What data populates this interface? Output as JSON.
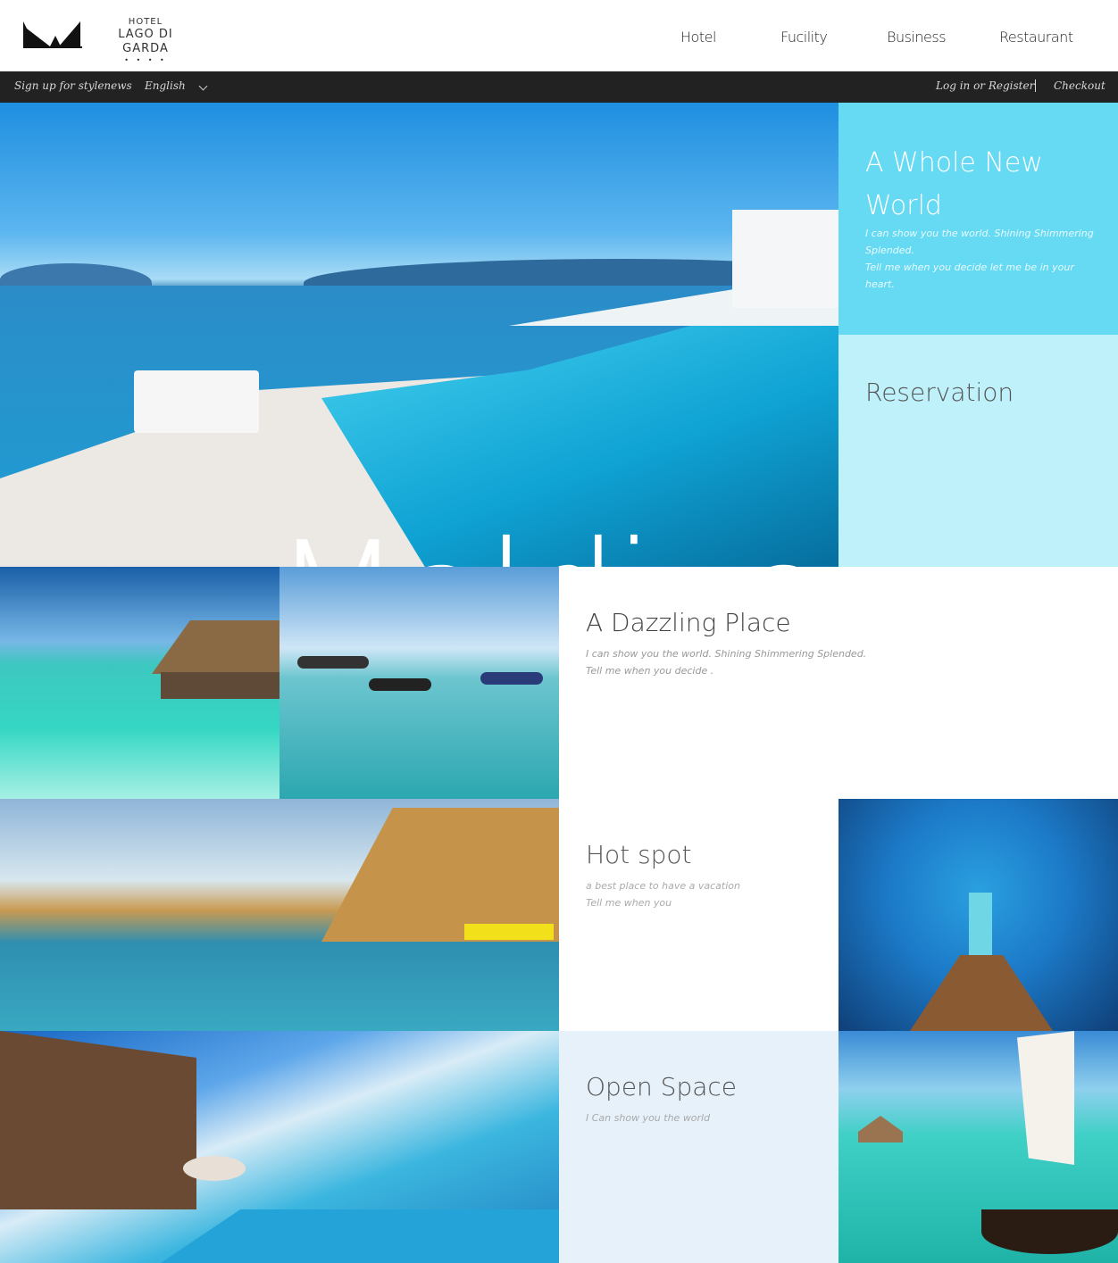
{
  "logo": {
    "hotel": "HOTEL",
    "name": "LAGO DI GARDA",
    "stars": "• • • •"
  },
  "nav": {
    "hotel": "Hotel",
    "facility": "Fucility",
    "business": "Business",
    "restaurant": "Restaurant"
  },
  "topbar": {
    "signup": "Sign up for stylenews",
    "language": "English",
    "login": "Log in or Register",
    "checkout": "Checkout"
  },
  "hero": {
    "title": "Maldives"
  },
  "panels": {
    "world": {
      "title_line1": "A Whole New",
      "title_line2": "World",
      "desc_line1": "I can show you the world. Shining Shimmering",
      "desc_line2": "Splended.",
      "desc_line3": "Tell me when you decide let me be in your heart."
    },
    "reservation": {
      "title": "Reservation"
    },
    "dazzling": {
      "title": "A Dazzling Place",
      "desc_line1": "I can show you the world. Shining Shimmering Splended.",
      "desc_line2": "Tell me when you decide ."
    },
    "hotspot": {
      "title": "Hot spot",
      "desc_line1": "a best place to have a vacation",
      "desc_line2": "Tell me when you"
    },
    "openspace": {
      "title": "Open Space",
      "desc_line1": "I Can show you the world"
    }
  },
  "colors": {
    "topbar_bg": "#222222",
    "world_bg": "#66d9f3",
    "reservation_bg": "#bff1fa",
    "openspace_bg": "#e6f1fa"
  }
}
